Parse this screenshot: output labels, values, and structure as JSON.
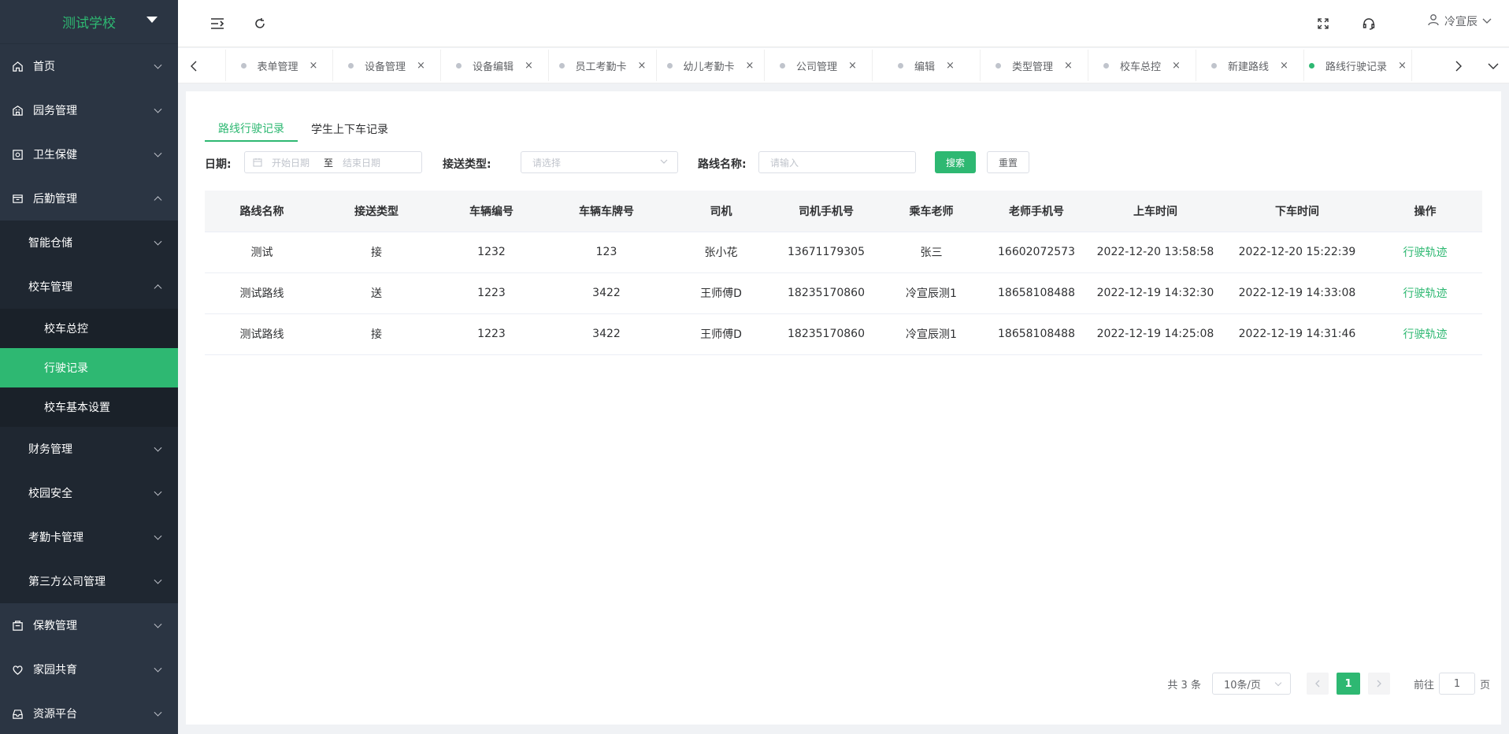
{
  "sidebar": {
    "logo": "测试学校",
    "menu": {
      "home": "首页",
      "campus": "园务管理",
      "health": "卫生保健",
      "logistics": "后勤管理",
      "smart_storage": "智能仓储",
      "bus_mgmt": "校车管理",
      "bus_control": "校车总控",
      "drive_record": "行驶记录",
      "bus_settings": "校车基本设置",
      "finance": "财务管理",
      "safety": "校园安全",
      "attendance": "考勤卡管理",
      "third_party": "第三方公司管理",
      "teaching": "保教管理",
      "home_school": "家园共育",
      "resources": "资源平台"
    }
  },
  "header": {
    "user": "冷宣辰"
  },
  "tabs": [
    {
      "label": "表单管理"
    },
    {
      "label": "设备管理"
    },
    {
      "label": "设备编辑"
    },
    {
      "label": "员工考勤卡"
    },
    {
      "label": "幼儿考勤卡"
    },
    {
      "label": "公司管理"
    },
    {
      "label": "编辑"
    },
    {
      "label": "类型管理"
    },
    {
      "label": "校车总控"
    },
    {
      "label": "新建路线"
    },
    {
      "label": "路线行驶记录",
      "active": true
    }
  ],
  "tab_close": "×",
  "subtabs": {
    "route": "路线行驶记录",
    "student": "学生上下车记录"
  },
  "filters": {
    "date_label": "日期:",
    "start_placeholder": "开始日期",
    "to": "至",
    "end_placeholder": "结束日期",
    "type_label": "接送类型:",
    "type_placeholder": "请选择",
    "route_label": "路线名称:",
    "route_placeholder": "请输入",
    "search": "搜索",
    "reset": "重置"
  },
  "table": {
    "headers": [
      "路线名称",
      "接送类型",
      "车辆编号",
      "车辆车牌号",
      "司机",
      "司机手机号",
      "乘车老师",
      "老师手机号",
      "上车时间",
      "下车时间",
      "操作"
    ],
    "rows": [
      [
        "测试",
        "接",
        "1232",
        "123",
        "张小花",
        "13671179305",
        "张三",
        "16602072573",
        "2022-12-20 13:58:58",
        "2022-12-20 15:22:39",
        "行驶轨迹"
      ],
      [
        "测试路线",
        "送",
        "1223",
        "3422",
        "王师傅D",
        "18235170860",
        "冷宣辰测1",
        "18658108488",
        "2022-12-19 14:32:30",
        "2022-12-19 14:33:08",
        "行驶轨迹"
      ],
      [
        "测试路线",
        "接",
        "1223",
        "3422",
        "王师傅D",
        "18235170860",
        "冷宣辰测1",
        "18658108488",
        "2022-12-19 14:25:08",
        "2022-12-19 14:31:46",
        "行驶轨迹"
      ]
    ]
  },
  "pagination": {
    "total": "共 3 条",
    "page_size": "10条/页",
    "current": "1",
    "goto_label": "前往",
    "goto_value": "1",
    "page_unit": "页"
  },
  "colors": {
    "accent": "#2eb872",
    "sidebar_bg": "#2b3543"
  }
}
